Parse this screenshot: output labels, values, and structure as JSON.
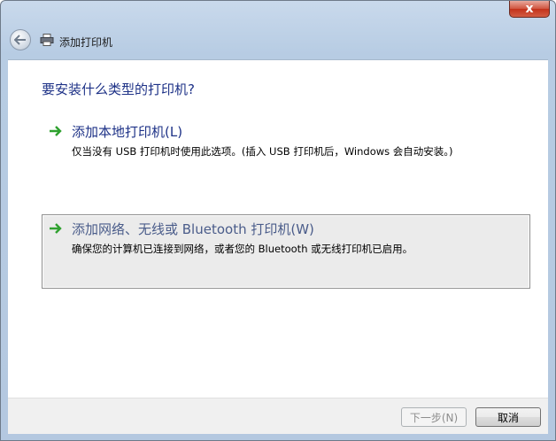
{
  "window": {
    "title": "添加打印机",
    "close_glyph": "x"
  },
  "main": {
    "heading": "要安装什么类型的打印机?",
    "options": [
      {
        "title": "添加本地打印机(L)",
        "description": "仅当没有 USB 打印机时使用此选项。(插入 USB 打印机后，Windows 会自动安装。)",
        "icon": "green-arrow-icon",
        "highlighted": false
      },
      {
        "title": "添加网络、无线或 Bluetooth 打印机(W)",
        "description": "确保您的计算机已连接到网络，或者您的 Bluetooth 或无线打印机已启用。",
        "icon": "green-arrow-icon",
        "highlighted": true
      }
    ]
  },
  "footer": {
    "next_label": "下一步(N)",
    "cancel_label": "取消",
    "next_enabled": false
  },
  "colors": {
    "heading": "#1e3287",
    "accent_arrow": "#2fa12f",
    "highlight_bg": "#ebebeb"
  }
}
